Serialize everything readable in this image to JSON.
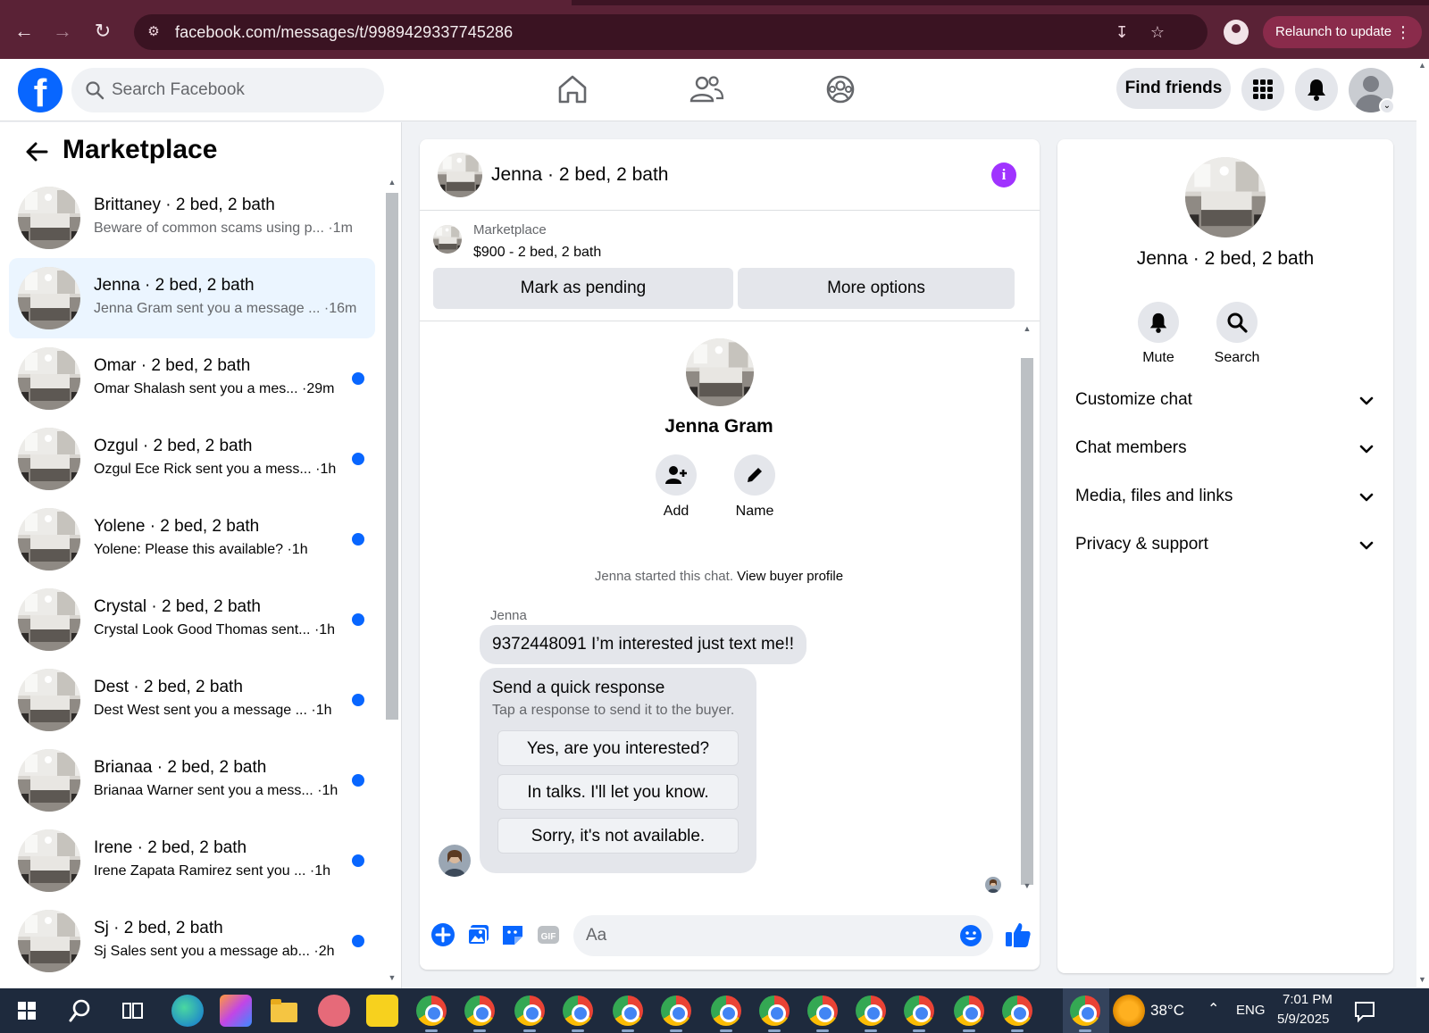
{
  "browser": {
    "url": "facebook.com/messages/t/9989429337745286",
    "relaunch_label": "Relaunch to update"
  },
  "header": {
    "logo": "f",
    "search_placeholder": "Search Facebook",
    "find_friends_label": "Find friends"
  },
  "sidebar": {
    "title": "Marketplace",
    "conversations": [
      {
        "name": "Brittaney · 2 bed, 2 bath",
        "preview": "Beware of common scams using p...",
        "time": "·1m",
        "unread": false,
        "active": false
      },
      {
        "name": "Jenna · 2 bed, 2 bath",
        "preview": "Jenna Gram sent you a message ...",
        "time": "·16m",
        "unread": false,
        "active": true
      },
      {
        "name": "Omar · 2 bed, 2 bath",
        "preview": "Omar Shalash sent you a mes...",
        "time": "·29m",
        "unread": true,
        "active": false
      },
      {
        "name": "Ozgul · 2 bed, 2 bath",
        "preview": "Ozgul Ece Rick sent you a mess...",
        "time": "·1h",
        "unread": true,
        "active": false
      },
      {
        "name": "Yolene · 2 bed, 2 bath",
        "preview": "Yolene: Please this available?",
        "time": "·1h",
        "unread": true,
        "active": false
      },
      {
        "name": "Crystal · 2 bed, 2 bath",
        "preview": "Crystal Look Good Thomas sent...",
        "time": "·1h",
        "unread": true,
        "active": false
      },
      {
        "name": "Dest · 2 bed, 2 bath",
        "preview": "Dest West sent you a message ...",
        "time": "·1h",
        "unread": true,
        "active": false
      },
      {
        "name": "Brianaa · 2 bed, 2 bath",
        "preview": "Brianaa Warner sent you a mess...",
        "time": "·1h",
        "unread": true,
        "active": false
      },
      {
        "name": "Irene · 2 bed, 2 bath",
        "preview": "Irene Zapata Ramirez sent you ...",
        "time": "·1h",
        "unread": true,
        "active": false
      },
      {
        "name": "Sj · 2 bed, 2 bath",
        "preview": "Sj Sales sent you a message ab...",
        "time": "·2h",
        "unread": true,
        "active": false
      }
    ]
  },
  "chat": {
    "title": "Jenna · 2 bed, 2 bath",
    "listing": {
      "category": "Marketplace",
      "price_line": "$900 - 2 bed, 2 bath",
      "mark_pending_label": "Mark as pending",
      "more_options_label": "More options"
    },
    "profile_name": "Jenna Gram",
    "add_label": "Add",
    "name_label": "Name",
    "started_text": "Jenna started this chat.",
    "view_buyer_profile": "View buyer profile",
    "sender": "Jenna",
    "message": "9372448091 I’m interested just text me!!",
    "quick_response": {
      "title": "Send a quick response",
      "subtitle": "Tap a response to send it to the buyer.",
      "options": [
        "Yes, are you interested?",
        "In talks. I'll let you know.",
        "Sorry, it's not available."
      ]
    },
    "composer_placeholder": "Aa"
  },
  "details": {
    "name": "Jenna · 2 bed, 2 bath",
    "mute_label": "Mute",
    "search_label": "Search",
    "sections": [
      "Customize chat",
      "Chat members",
      "Media, files and links",
      "Privacy & support"
    ]
  },
  "taskbar": {
    "temperature": "38°C",
    "language": "ENG",
    "time": "7:01 PM",
    "date": "5/9/2025"
  },
  "colors": {
    "fb_blue": "#0866ff",
    "chrome_bg": "#5a2236",
    "active_conv": "#ebf5ff",
    "info_purple": "#a033ff"
  }
}
